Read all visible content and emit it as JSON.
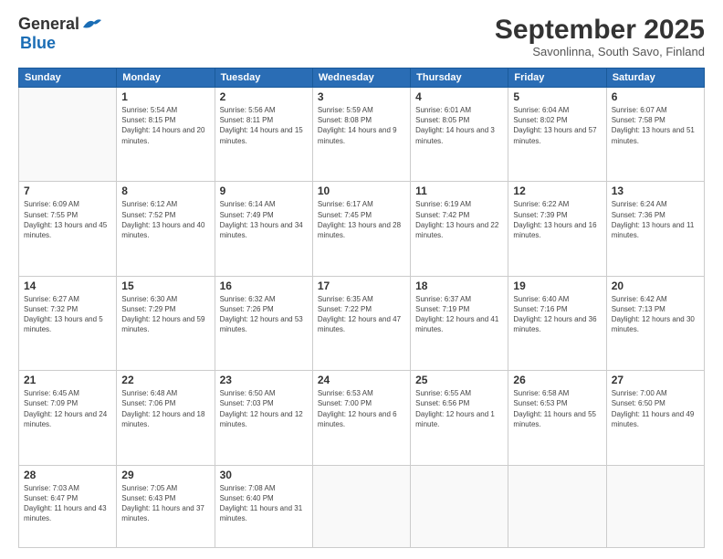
{
  "logo": {
    "line1": "General",
    "line2": "Blue"
  },
  "header": {
    "title": "September 2025",
    "subtitle": "Savonlinna, South Savo, Finland"
  },
  "weekdays": [
    "Sunday",
    "Monday",
    "Tuesday",
    "Wednesday",
    "Thursday",
    "Friday",
    "Saturday"
  ],
  "days": [
    {
      "date": null,
      "sunrise": null,
      "sunset": null,
      "daylight": null
    },
    {
      "date": "1",
      "sunrise": "5:54 AM",
      "sunset": "8:15 PM",
      "daylight": "14 hours and 20 minutes."
    },
    {
      "date": "2",
      "sunrise": "5:56 AM",
      "sunset": "8:11 PM",
      "daylight": "14 hours and 15 minutes."
    },
    {
      "date": "3",
      "sunrise": "5:59 AM",
      "sunset": "8:08 PM",
      "daylight": "14 hours and 9 minutes."
    },
    {
      "date": "4",
      "sunrise": "6:01 AM",
      "sunset": "8:05 PM",
      "daylight": "14 hours and 3 minutes."
    },
    {
      "date": "5",
      "sunrise": "6:04 AM",
      "sunset": "8:02 PM",
      "daylight": "13 hours and 57 minutes."
    },
    {
      "date": "6",
      "sunrise": "6:07 AM",
      "sunset": "7:58 PM",
      "daylight": "13 hours and 51 minutes."
    },
    {
      "date": "7",
      "sunrise": "6:09 AM",
      "sunset": "7:55 PM",
      "daylight": "13 hours and 45 minutes."
    },
    {
      "date": "8",
      "sunrise": "6:12 AM",
      "sunset": "7:52 PM",
      "daylight": "13 hours and 40 minutes."
    },
    {
      "date": "9",
      "sunrise": "6:14 AM",
      "sunset": "7:49 PM",
      "daylight": "13 hours and 34 minutes."
    },
    {
      "date": "10",
      "sunrise": "6:17 AM",
      "sunset": "7:45 PM",
      "daylight": "13 hours and 28 minutes."
    },
    {
      "date": "11",
      "sunrise": "6:19 AM",
      "sunset": "7:42 PM",
      "daylight": "13 hours and 22 minutes."
    },
    {
      "date": "12",
      "sunrise": "6:22 AM",
      "sunset": "7:39 PM",
      "daylight": "13 hours and 16 minutes."
    },
    {
      "date": "13",
      "sunrise": "6:24 AM",
      "sunset": "7:36 PM",
      "daylight": "13 hours and 11 minutes."
    },
    {
      "date": "14",
      "sunrise": "6:27 AM",
      "sunset": "7:32 PM",
      "daylight": "13 hours and 5 minutes."
    },
    {
      "date": "15",
      "sunrise": "6:30 AM",
      "sunset": "7:29 PM",
      "daylight": "12 hours and 59 minutes."
    },
    {
      "date": "16",
      "sunrise": "6:32 AM",
      "sunset": "7:26 PM",
      "daylight": "12 hours and 53 minutes."
    },
    {
      "date": "17",
      "sunrise": "6:35 AM",
      "sunset": "7:22 PM",
      "daylight": "12 hours and 47 minutes."
    },
    {
      "date": "18",
      "sunrise": "6:37 AM",
      "sunset": "7:19 PM",
      "daylight": "12 hours and 41 minutes."
    },
    {
      "date": "19",
      "sunrise": "6:40 AM",
      "sunset": "7:16 PM",
      "daylight": "12 hours and 36 minutes."
    },
    {
      "date": "20",
      "sunrise": "6:42 AM",
      "sunset": "7:13 PM",
      "daylight": "12 hours and 30 minutes."
    },
    {
      "date": "21",
      "sunrise": "6:45 AM",
      "sunset": "7:09 PM",
      "daylight": "12 hours and 24 minutes."
    },
    {
      "date": "22",
      "sunrise": "6:48 AM",
      "sunset": "7:06 PM",
      "daylight": "12 hours and 18 minutes."
    },
    {
      "date": "23",
      "sunrise": "6:50 AM",
      "sunset": "7:03 PM",
      "daylight": "12 hours and 12 minutes."
    },
    {
      "date": "24",
      "sunrise": "6:53 AM",
      "sunset": "7:00 PM",
      "daylight": "12 hours and 6 minutes."
    },
    {
      "date": "25",
      "sunrise": "6:55 AM",
      "sunset": "6:56 PM",
      "daylight": "12 hours and 1 minute."
    },
    {
      "date": "26",
      "sunrise": "6:58 AM",
      "sunset": "6:53 PM",
      "daylight": "11 hours and 55 minutes."
    },
    {
      "date": "27",
      "sunrise": "7:00 AM",
      "sunset": "6:50 PM",
      "daylight": "11 hours and 49 minutes."
    },
    {
      "date": "28",
      "sunrise": "7:03 AM",
      "sunset": "6:47 PM",
      "daylight": "11 hours and 43 minutes."
    },
    {
      "date": "29",
      "sunrise": "7:05 AM",
      "sunset": "6:43 PM",
      "daylight": "11 hours and 37 minutes."
    },
    {
      "date": "30",
      "sunrise": "7:08 AM",
      "sunset": "6:40 PM",
      "daylight": "11 hours and 31 minutes."
    }
  ]
}
